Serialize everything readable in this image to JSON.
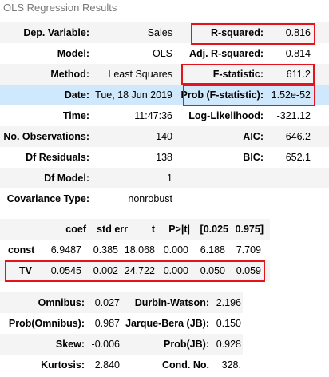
{
  "caption": "OLS Regression Results",
  "summary": {
    "rows": [
      {
        "l1": "Dep. Variable:",
        "v1": "Sales",
        "l2": "R-squared:",
        "v2": "0.816"
      },
      {
        "l1": "Model:",
        "v1": "OLS",
        "l2": "Adj. R-squared:",
        "v2": "0.814"
      },
      {
        "l1": "Method:",
        "v1": "Least Squares",
        "l2": "F-statistic:",
        "v2": "611.2"
      },
      {
        "l1": "Date:",
        "v1": "Tue, 18 Jun 2019",
        "l2": "Prob (F-statistic):",
        "v2": "1.52e-52"
      },
      {
        "l1": "Time:",
        "v1": "11:47:36",
        "l2": "Log-Likelihood:",
        "v2": "-321.12"
      },
      {
        "l1": "No. Observations:",
        "v1": "140",
        "l2": "AIC:",
        "v2": "646.2"
      },
      {
        "l1": "Df Residuals:",
        "v1": "138",
        "l2": "BIC:",
        "v2": "652.1"
      },
      {
        "l1": "Df Model:",
        "v1": "1",
        "l2": "",
        "v2": ""
      },
      {
        "l1": "Covariance Type:",
        "v1": "nonrobust",
        "l2": "",
        "v2": ""
      }
    ]
  },
  "coefficients": {
    "headers": [
      "",
      "coef",
      "std err",
      "t",
      "P>|t|",
      "[0.025",
      "0.975]"
    ],
    "rows": [
      [
        "const",
        "6.9487",
        "0.385",
        "18.068",
        "0.000",
        "6.188",
        "7.709"
      ],
      [
        "TV",
        "0.0545",
        "0.002",
        "24.722",
        "0.000",
        "0.050",
        "0.059"
      ]
    ]
  },
  "diagnostics": {
    "rows": [
      {
        "l1": "Omnibus:",
        "v1": "0.027",
        "l2": "Durbin-Watson:",
        "v2": "2.196"
      },
      {
        "l1": "Prob(Omnibus):",
        "v1": "0.987",
        "l2": "Jarque-Bera (JB):",
        "v2": "0.150"
      },
      {
        "l1": "Skew:",
        "v1": "-0.006",
        "l2": "Prob(JB):",
        "v2": "0.928"
      },
      {
        "l1": "Kurtosis:",
        "v1": "2.840",
        "l2": "Cond. No.",
        "v2": "328."
      }
    ]
  },
  "colors": {
    "row_shade": "#f4f4f4",
    "row_highlight": "#cfe8fb",
    "annotation_box": "#e3141b",
    "caption_text": "#7a7a7a"
  }
}
